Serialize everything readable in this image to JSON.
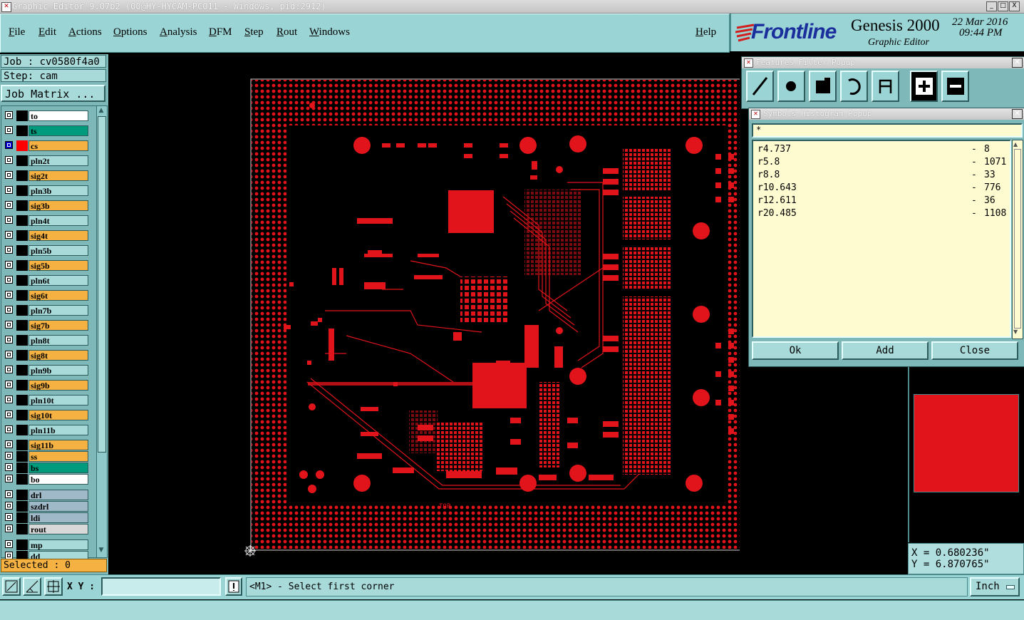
{
  "window": {
    "title": "Graphic Editor 9.07b2 (00@HY-HYCAM-PC011 - Windows, pid:2912)",
    "controls": [
      "_",
      "□",
      "X"
    ]
  },
  "menu": {
    "items": [
      "File",
      "Edit",
      "Actions",
      "Options",
      "Analysis",
      "DFM",
      "Step",
      "Rout",
      "Windows"
    ],
    "help": "Help"
  },
  "brand": {
    "logo": "Frontline",
    "product": "Genesis 2000",
    "module": "Graphic Editor",
    "date": "22 Mar 2016",
    "time": "09:44 PM"
  },
  "job": {
    "job_label": "Job : cv0580f4a0",
    "step_label": "Step: cam",
    "matrix_button": "Job Matrix ..."
  },
  "layers": [
    {
      "name": "to",
      "color": "#ffffff",
      "checked": false
    },
    {
      "name": "ts",
      "color": "#009b7d",
      "checked": false
    },
    {
      "name": "cs",
      "color": "#f5b142",
      "checked": true,
      "swatch": "#ff0000"
    },
    {
      "name": "pln2t",
      "color": "#a8dada",
      "checked": false
    },
    {
      "name": "sig2t",
      "color": "#f5b142",
      "checked": false
    },
    {
      "name": "pln3b",
      "color": "#a8dada",
      "checked": false
    },
    {
      "name": "sig3b",
      "color": "#f5b142",
      "checked": false
    },
    {
      "name": "pln4t",
      "color": "#a8dada",
      "checked": false
    },
    {
      "name": "sig4t",
      "color": "#f5b142",
      "checked": false
    },
    {
      "name": "pln5b",
      "color": "#a8dada",
      "checked": false
    },
    {
      "name": "sig5b",
      "color": "#f5b142",
      "checked": false
    },
    {
      "name": "pln6t",
      "color": "#a8dada",
      "checked": false
    },
    {
      "name": "sig6t",
      "color": "#f5b142",
      "checked": false
    },
    {
      "name": "pln7b",
      "color": "#a8dada",
      "checked": false
    },
    {
      "name": "sig7b",
      "color": "#f5b142",
      "checked": false
    },
    {
      "name": "pln8t",
      "color": "#a8dada",
      "checked": false
    },
    {
      "name": "sig8t",
      "color": "#f5b142",
      "checked": false
    },
    {
      "name": "pln9b",
      "color": "#a8dada",
      "checked": false
    },
    {
      "name": "sig9b",
      "color": "#f5b142",
      "checked": false
    },
    {
      "name": "pln10t",
      "color": "#a8dada",
      "checked": false
    },
    {
      "name": "sig10t",
      "color": "#f5b142",
      "checked": false
    },
    {
      "name": "pln11b",
      "color": "#a8dada",
      "checked": false
    },
    {
      "name": "sig11b",
      "color": "#f5b142",
      "checked": false
    },
    {
      "name": "ss",
      "color": "#f5b142",
      "checked": false
    },
    {
      "name": "bs",
      "color": "#009b7d",
      "checked": false
    },
    {
      "name": "bo",
      "color": "#ffffff",
      "checked": false
    },
    {
      "name": "drl",
      "color": "#9fb9c8",
      "checked": false
    },
    {
      "name": "szdrl",
      "color": "#9fb9c8",
      "checked": false
    },
    {
      "name": "ldi",
      "color": "#9fb9c8",
      "checked": false
    },
    {
      "name": "rout",
      "color": "#d8d8d8",
      "checked": false
    },
    {
      "name": "mp",
      "color": "#a8dada",
      "checked": false
    },
    {
      "name": "dd",
      "color": "#a8dada",
      "checked": false
    }
  ],
  "selected": "Selected : 0",
  "canvas": {
    "board_label": "TOP",
    "feature_color": "#e0141a"
  },
  "features_filter": {
    "title": "Features Filter Popup",
    "buttons": [
      "line-icon",
      "pad-icon",
      "surface-icon",
      "arc-icon",
      "text-icon",
      "plus-icon",
      "minus-icon"
    ]
  },
  "histogram": {
    "title": "Symbols Histogram Popup",
    "filter_value": "*",
    "rows": [
      {
        "symbol": "r4.737",
        "count": "8"
      },
      {
        "symbol": "r5.8",
        "count": "1071"
      },
      {
        "symbol": "r8.8",
        "count": "33"
      },
      {
        "symbol": "r10.643",
        "count": "776"
      },
      {
        "symbol": "r12.611",
        "count": "36"
      },
      {
        "symbol": "r20.485",
        "count": "1108"
      }
    ],
    "buttons": {
      "ok": "Ok",
      "add": "Add",
      "close": "Close"
    }
  },
  "coords": {
    "x": "X = 0.680236\"",
    "y": "Y = 6.870765\""
  },
  "bottom": {
    "xy_label": "X Y :",
    "xy_value": "",
    "message": "<M1> - Select first corner",
    "units": "Inch"
  }
}
